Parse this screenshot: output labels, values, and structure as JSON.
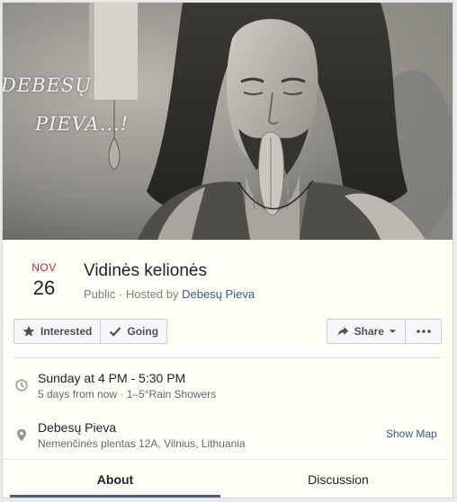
{
  "cover": {
    "text_line1": "DEBESŲ",
    "text_line2": "PIEVA...!"
  },
  "event": {
    "month": "NOV",
    "day": "26",
    "title": "Vidinės kelionės",
    "visibility": "Public · Hosted by",
    "host": "Debesų Pieva"
  },
  "actions": {
    "interested": "Interested",
    "going": "Going",
    "share": "Share"
  },
  "time": {
    "main": "Sunday at 4 PM - 5:30 PM",
    "sub": "5 days from now · 1–5°Rain Showers"
  },
  "location": {
    "name": "Debesų Pieva",
    "address": "Nemenčinės plentas 12A, Vilnius, Lithuania",
    "show_map": "Show Map"
  },
  "tabs": {
    "about": "About",
    "discussion": "Discussion"
  },
  "colors": {
    "date_month": "#c4282d",
    "link": "#385898",
    "tab_active": "#4b5896"
  },
  "icons": [
    "star-icon",
    "check-icon",
    "share-arrow-icon",
    "caret-down-icon",
    "more-dots-icon",
    "clock-icon",
    "location-pin-icon"
  ]
}
